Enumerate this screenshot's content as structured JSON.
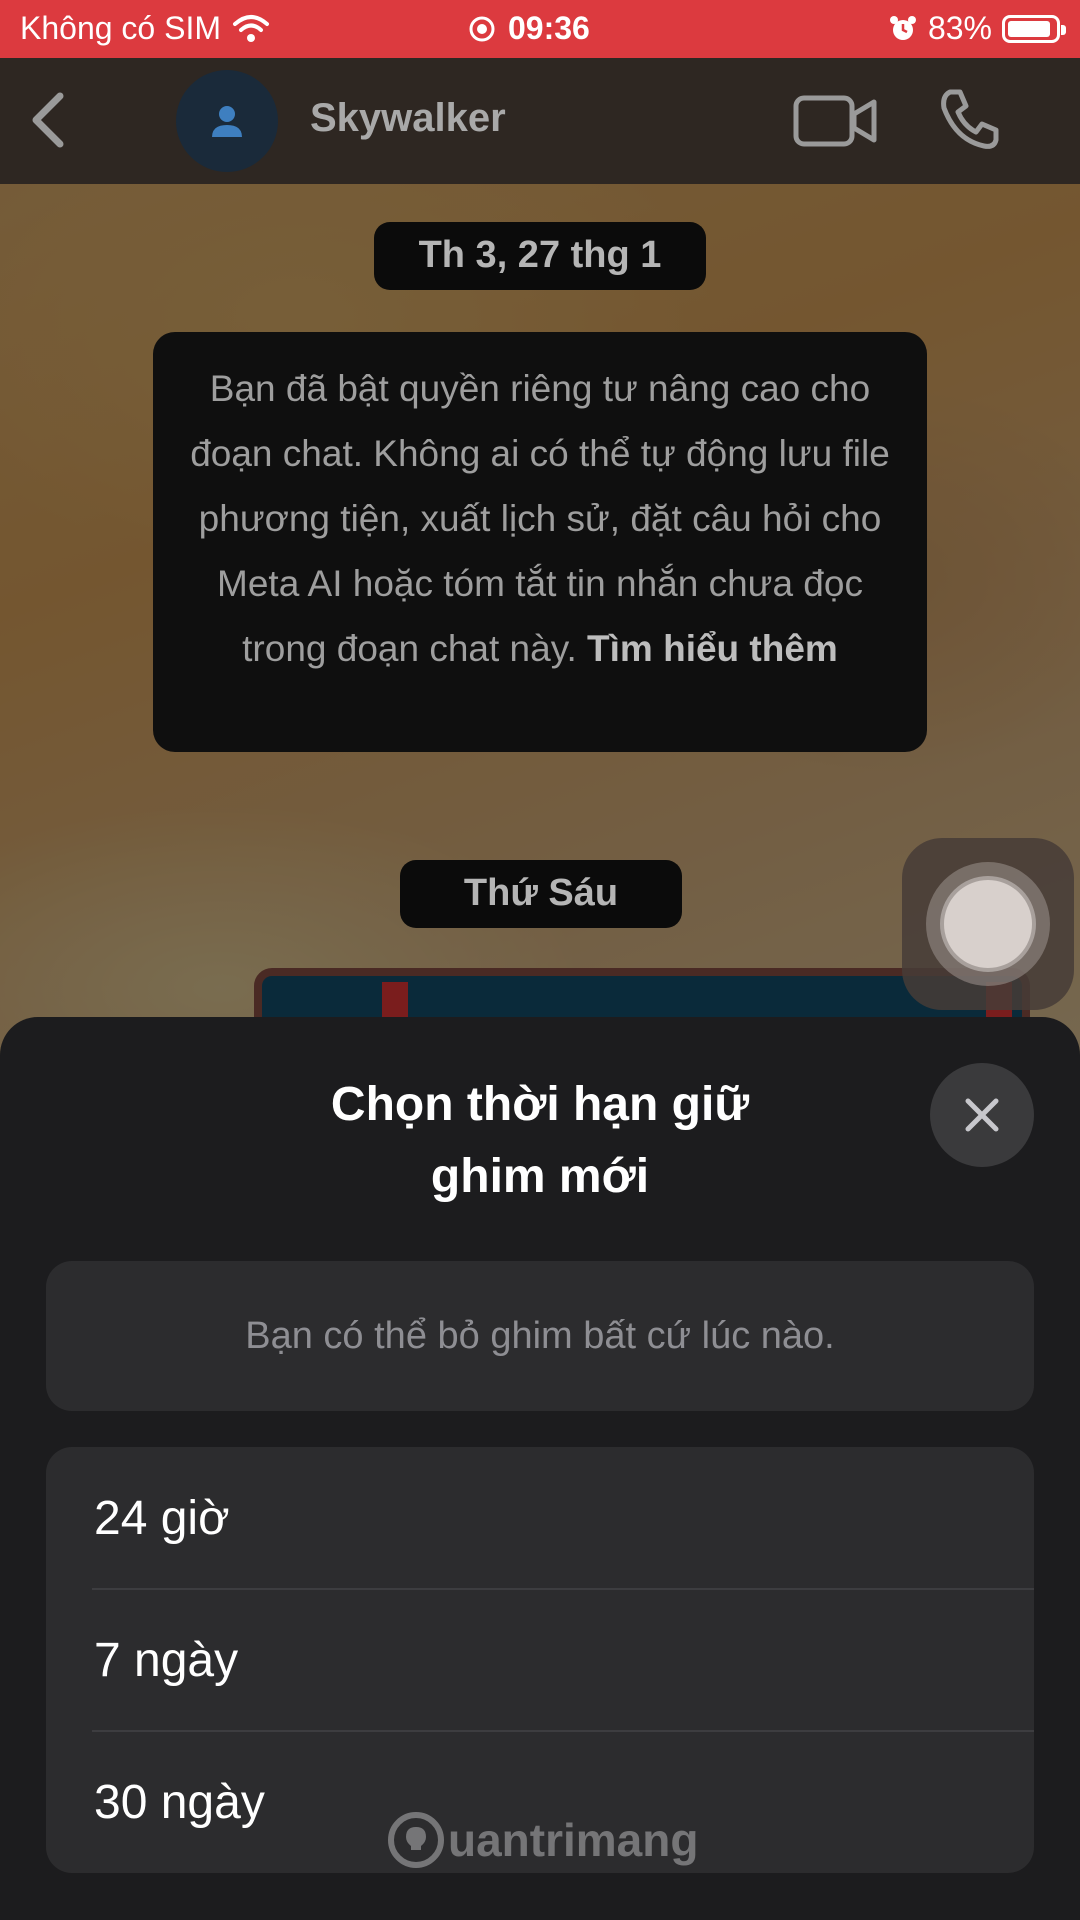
{
  "status_bar": {
    "carrier": "Không có SIM",
    "time": "09:36",
    "battery": "83%",
    "battery_level": 0.83,
    "icons": [
      "wifi-icon",
      "record-icon",
      "alarm-icon",
      "battery-icon"
    ]
  },
  "header": {
    "contact_name": "Skywalker",
    "icons": [
      "back-icon",
      "avatar-person-icon",
      "video-call-icon",
      "phone-icon"
    ]
  },
  "chat": {
    "date1": "Th 3, 27 thg 1",
    "notice_text": "Bạn đã bật quyền riêng tư nâng cao cho đoạn chat. Không ai có thể tự động lưu file phương tiện, xuất lịch sử, đặt câu hỏi cho Meta AI hoặc tóm tắt tin nhắn chưa đọc trong đoạn chat này.",
    "notice_link": "Tìm hiểu thêm",
    "date2": "Thứ Sáu"
  },
  "sheet": {
    "title_line1": "Chọn thời hạn giữ",
    "title_line2": "ghim mới",
    "info": "Bạn có thể bỏ ghim bất cứ lúc nào.",
    "options": [
      {
        "label": "24 giờ"
      },
      {
        "label": "7 ngày"
      },
      {
        "label": "30 ngày"
      }
    ]
  },
  "watermark": {
    "text": "uantrimang"
  },
  "colors": {
    "status_bar": "#dc3a3f",
    "sheet_bg": "#1c1c1e",
    "card_bg": "#2c2c2e"
  }
}
